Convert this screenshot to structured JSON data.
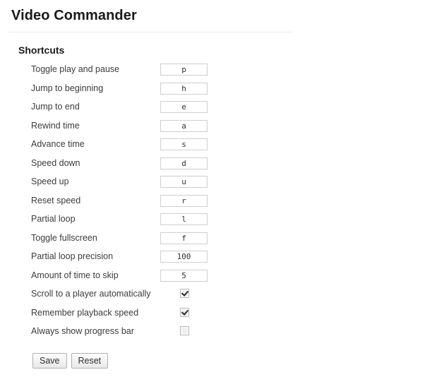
{
  "header": {
    "app_title": "Video Commander"
  },
  "section": {
    "title": "Shortcuts"
  },
  "shortcuts": [
    {
      "label": "Toggle play and pause",
      "value": "p",
      "type": "text"
    },
    {
      "label": "Jump to beginning",
      "value": "h",
      "type": "text"
    },
    {
      "label": "Jump to end",
      "value": "e",
      "type": "text"
    },
    {
      "label": "Rewind time",
      "value": "a",
      "type": "text"
    },
    {
      "label": "Advance time",
      "value": "s",
      "type": "text"
    },
    {
      "label": "Speed down",
      "value": "d",
      "type": "text"
    },
    {
      "label": "Speed up",
      "value": "u",
      "type": "text"
    },
    {
      "label": "Reset speed",
      "value": "r",
      "type": "text"
    },
    {
      "label": "Partial loop",
      "value": "l",
      "type": "text"
    },
    {
      "label": "Toggle fullscreen",
      "value": "f",
      "type": "text"
    },
    {
      "label": "Partial loop precision",
      "value": "100",
      "type": "text"
    },
    {
      "label": "Amount of time to skip",
      "value": "5",
      "type": "text"
    },
    {
      "label": "Scroll to a player automatically",
      "value": true,
      "type": "checkbox"
    },
    {
      "label": "Remember playback speed",
      "value": true,
      "type": "checkbox"
    },
    {
      "label": "Always show progress bar",
      "value": false,
      "type": "checkbox"
    }
  ],
  "actions": {
    "save_label": "Save",
    "reset_label": "Reset"
  },
  "colors": {
    "page_background": "#ffffff",
    "title_text": "#1a1a1a",
    "label_text": "#3b3b3b",
    "divider": "#eeeeee",
    "input_border": "#cfcfcf",
    "button_border": "#b0b0b0"
  }
}
